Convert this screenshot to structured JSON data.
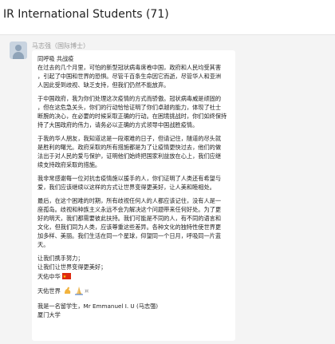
{
  "window": {
    "title": "IR International Students (71)"
  },
  "message": {
    "sender": "马志强（国际博士）",
    "paragraphs": [
      [
        "同呼吸 共战疫",
        "在过去的几个月里，可怕的新型冠状病毒席卷中国，政府和人民均受其害",
        "，引起了中国和世界的恐惧。尽管千百条生命因它而逝，尽管华人和亚洲",
        "人因此受到歧视、缺乏支持，但我们仍然不能放弃。"
      ],
      [
        "于中国政府，我为你们处理这次疫情的方式而骄傲。冠状病毒威是顽固的",
        "，但在这危急关头，你们的行动恰恰证明了你们卓越的能力，体现了社士",
        "断腕的决心，在必要的时候采取正确的行动。在困境挑战时，你们如终保持",
        "持了大国政府的伟力，请务必以正确的方式领导中国战胜疫情。"
      ],
      [
        "于我的华人朋友，我知道这是一段艰难的日子，但请记住，隧道的尽头就",
        "是胜利的曙光。政府采取的所有措施都是为了让疫情更快过去，他们的做",
        "法出于对人民的爱与保护，证明他们始终把国家利益放在心上，我们应继",
        "续支持政府采取的措施。"
      ],
      [
        "我非常感谢每一位对抗击疫情施以援手的人，你们证明了人类还有希望与",
        "爱，我们应该继续以这样的方式让世界变得更美好，让人美和睦相处。"
      ],
      [
        "最后，在这个困难的时期，所有歧视任何人的人都应该记住，没有人是一",
        "座孤岛。歧视和种族主义永远不会为解决这个问题带来任何好处。为了更",
        "好的明天，我们都需要彼此扶持。我们可能是不同的人，有不同的语言和",
        "文化，但我们同为人类，应该尊重这些差异。各种文化的独特性使世界更",
        "加多样、美丽。我们生活在同一个星球，仰望同一个日月，呼吸同一片蓝",
        "天。"
      ],
      [
        "让我们携手努力；",
        "让我们让世界变得更美好；"
      ]
    ],
    "blessing_china": "天佑中华",
    "blessing_world": "天佑世界",
    "signature": [
      "我是一名留学生，Mr Emmanuel I. U (马志强)",
      "厦门大学"
    ]
  }
}
